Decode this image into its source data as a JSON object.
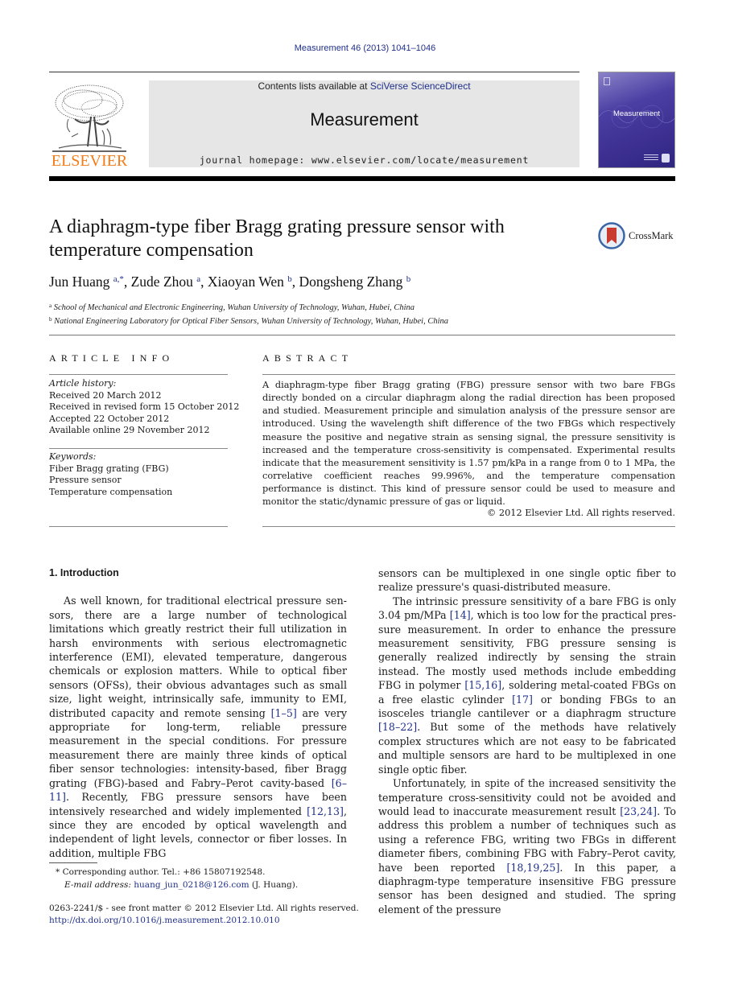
{
  "header": {
    "citation": "Measurement 46 (2013) 1041–1046",
    "contents_prefix": "Contents lists available at ",
    "contents_link": "SciVerse ScienceDirect",
    "journal_name": "Measurement",
    "homepage": "journal homepage: www.elsevier.com/locate/measurement",
    "publisher_logo_text": "ELSEVIER",
    "cover_title": "Measurement",
    "colors": {
      "publisher_orange": "#f07c1a",
      "link_blue": "#1f2f8c",
      "cover_purple": "#3c2f91"
    }
  },
  "article": {
    "title": "A diaphragm-type fiber Bragg grating pressure sensor with temperature compensation",
    "crossmark_label": "CrossMark",
    "authors": [
      {
        "name": "Jun Huang",
        "sup": "a,*"
      },
      {
        "name": "Zude Zhou",
        "sup": "a"
      },
      {
        "name": "Xiaoyan Wen",
        "sup": "b"
      },
      {
        "name": "Dongsheng Zhang",
        "sup": "b"
      }
    ],
    "affiliations": [
      {
        "sup": "a",
        "text": "School of Mechanical and Electronic Engineering, Wuhan University of Technology, Wuhan, Hubei, China"
      },
      {
        "sup": "b",
        "text": "National Engineering Laboratory for Optical Fiber Sensors, Wuhan University of Technology, Wuhan, Hubei, China"
      }
    ]
  },
  "article_info": {
    "heading": "ARTICLE INFO",
    "history_label": "Article history:",
    "history": [
      "Received 20 March 2012",
      "Received in revised form 15 October 2012",
      "Accepted 22 October 2012",
      "Available online 29 November 2012"
    ],
    "keywords_label": "Keywords:",
    "keywords": [
      "Fiber Bragg grating (FBG)",
      "Pressure sensor",
      "Temperature compensation"
    ]
  },
  "abstract": {
    "heading": "ABSTRACT",
    "text": "A diaphragm-type fiber Bragg grating (FBG) pressure sensor with two bare FBGs directly bonded on a circular diaphragm along the radial direction has been proposed and studied. Measurement principle and simulation analysis of the pressure sensor are introduced. Using the wavelength shift difference of the two FBGs which respectively measure the positive and negative strain as sensing signal, the pressure sensitivity is increased and the temperature cross-sensitivity is compensated. Experimental results indicate that the measurement sensitivity is 1.57 pm/kPa in a range from 0 to 1 MPa, the correlative coeffi­cient reaches 99.996%, and the temperature compensation performance is distinct. This kind of pressure sensor could be used to measure and monitor the static/dynamic pressure of gas or liquid.",
    "copyright": "© 2012 Elsevier Ltd. All rights reserved."
  },
  "body": {
    "section_heading": "1. Introduction",
    "left": {
      "p1_a": "As well known, for traditional electrical pressure sen­sors, there are a large number of technological limitations which greatly restrict their full utilization in harsh environ­ments with serious electromagnetic interference (EMI), ele­vated temperature, dangerous chemicals or explosion matters. While to optical fiber sensors (OFSs), their obvious advantages such as small size, light weight, intrinsically safe, immunity to EMI, distributed capacity and remote sensing ",
      "ref1": "[1–5]",
      "p1_b": " are very appropriate for long-term, reliable pressure measurement in the special conditions. For pres­sure measurement there are mainly three kinds of optical fiber sensor technologies: intensity-based, fiber Bragg grat­ing (FBG)-based and Fabry–Perot cavity-based ",
      "ref2": "[6–11]",
      "p1_c": ". Recently, FBG pressure sensors have been intensively researched and widely implemented ",
      "ref3": "[12,13]",
      "p1_d": ", since they are encoded by optical wavelength and independent of light levels, connector or fiber losses. In addition, multiple FBG"
    },
    "right": {
      "p0": "sensors can be multiplexed in one single optic fiber to real­ize pressure's quasi-distributed measure.",
      "p1_a": "The intrinsic pressure sensitivity of a bare FBG is only 3.04 pm/MPa ",
      "ref1": "[14]",
      "p1_b": ", which is too low for the practical pres­sure measurement. In order to enhance the pressure mea­surement sensitivity, FBG pressure sensing is generally realized indirectly by sensing the strain instead. The mostly used methods include embedding FBG in polymer ",
      "ref2": "[15,16]",
      "p1_c": ", soldering metal-coated FBGs on a free elastic cylin­der ",
      "ref3": "[17]",
      "p1_d": " or bonding FBGs to an isosceles triangle cantilever or a diaphragm structure ",
      "ref4": "[18–22]",
      "p1_e": ". But some of the meth­ods have relatively complex structures which are not easy to be fabricated and multiple sensors are hard to be multi­plexed in one single optic fiber.",
      "p2_a": "Unfortunately, in spite of the increased sensitivity the temperature cross-sensitivity could not be avoided and would lead to inaccurate measurement result ",
      "ref5": "[23,24]",
      "p2_b": ". To address this problem a number of techniques such as using a reference FBG, writing two FBGs in different diameter fibers, combining FBG with Fabry–Perot cavity, have been reported ",
      "ref6": "[18,19,25]",
      "p2_c": ". In this paper, a diaphragm-type temperature insensitive FBG pressure sensor has been designed and studied. The spring element of the pressure"
    }
  },
  "footnotes": {
    "corresponding": "* Corresponding author. Tel.: +86 15807192548.",
    "email_label": "E-mail address:",
    "email": "huang_jun_0218@126.com",
    "email_suffix": " (J. Huang).",
    "issn": "0263-2241/$ - see front matter © 2012 Elsevier Ltd. All rights reserved.",
    "doi": "http://dx.doi.org/10.1016/j.measurement.2012.10.010"
  }
}
